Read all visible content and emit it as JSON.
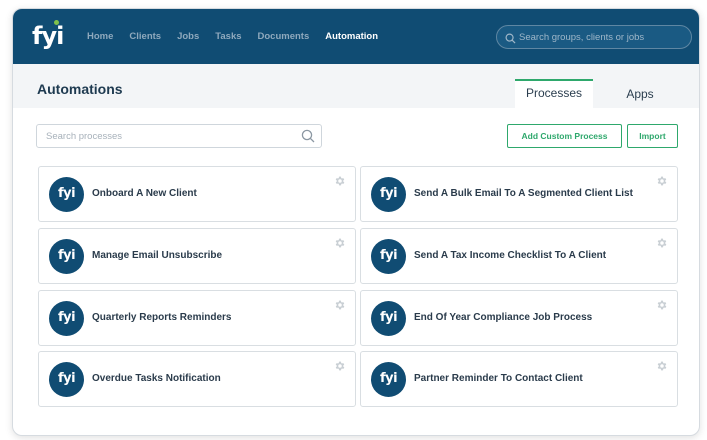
{
  "logo": {
    "text": "fyi"
  },
  "nav": {
    "items": [
      {
        "label": "Home"
      },
      {
        "label": "Clients"
      },
      {
        "label": "Jobs"
      },
      {
        "label": "Tasks"
      },
      {
        "label": "Documents"
      },
      {
        "label": "Automation"
      }
    ],
    "active": "Automation"
  },
  "global_search": {
    "placeholder": "Search groups, clients or jobs",
    "icon": "search-icon"
  },
  "page": {
    "title": "Automations"
  },
  "tabs": [
    {
      "label": "Processes",
      "active": true
    },
    {
      "label": "Apps",
      "active": false
    }
  ],
  "process_search": {
    "placeholder": "Search processes",
    "icon": "search-icon"
  },
  "actions": {
    "add_label": "Add Custom Process",
    "import_label": "Import"
  },
  "cards": [
    {
      "avatar": "fyi",
      "title": "Onboard A New Client"
    },
    {
      "avatar": "fyi",
      "title": "Send A Bulk Email To A Segmented Client List"
    },
    {
      "avatar": "fyi",
      "title": "Manage Email Unsubscribe"
    },
    {
      "avatar": "fyi",
      "title": "Send A Tax Income Checklist To A Client"
    },
    {
      "avatar": "fyi",
      "title": "Quarterly Reports Reminders"
    },
    {
      "avatar": "fyi",
      "title": "End Of Year Compliance Job Process"
    },
    {
      "avatar": "fyi",
      "title": "Overdue Tasks Notification"
    },
    {
      "avatar": "fyi",
      "title": "Partner Reminder To Contact Client"
    }
  ],
  "colors": {
    "header_bg": "#104c73",
    "accent_green": "#2ea86c",
    "avatar_bg": "#104c73",
    "logo_dot": "#7fc04b"
  }
}
